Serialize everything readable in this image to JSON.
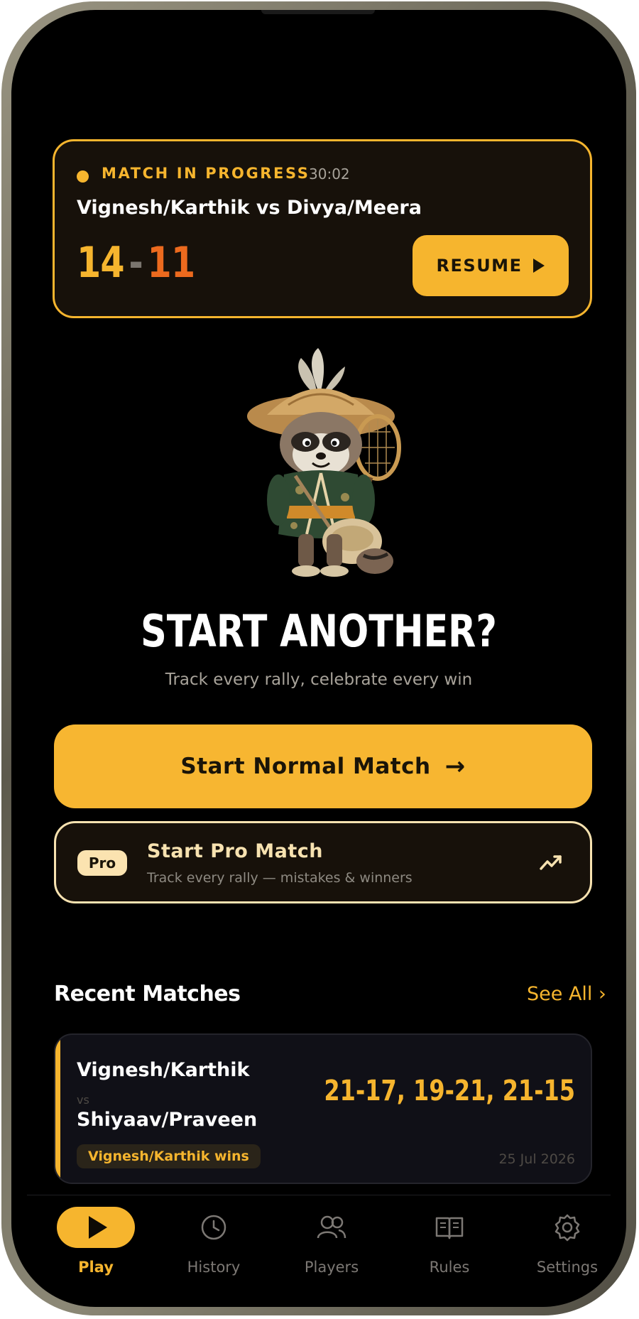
{
  "current_match": {
    "status_label": "MATCH IN PROGRESS",
    "timer": "30:02",
    "title": "Vignesh/Karthik vs Divya/Meera",
    "score_a": "14",
    "score_separator": "-",
    "score_b": "11",
    "resume_label": "RESUME"
  },
  "hero": {
    "title": "START ANOTHER?",
    "subtitle": "Track every rally, celebrate every win",
    "mascot_icon": "raccoon-badminton-mascot"
  },
  "actions": {
    "normal_label": "Start Normal Match",
    "pro_badge": "Pro",
    "pro_title": "Start Pro Match",
    "pro_subtitle": "Track every rally — mistakes & winners"
  },
  "recent": {
    "title": "Recent Matches",
    "see_all": "See All ›",
    "matches": [
      {
        "team_a": "Vignesh/Karthik",
        "vs": "vs",
        "team_b": "Shiyaav/Praveen",
        "winner": "Vignesh/Karthik wins",
        "scores": "21-17, 19-21, 21-15",
        "date": "25 Jul 2026"
      }
    ]
  },
  "nav": {
    "items": [
      {
        "label": "Play",
        "icon": "play-icon",
        "active": true
      },
      {
        "label": "History",
        "icon": "clock-icon"
      },
      {
        "label": "Players",
        "icon": "users-icon"
      },
      {
        "label": "Rules",
        "icon": "book-icon"
      },
      {
        "label": "Settings",
        "icon": "gear-icon"
      }
    ]
  },
  "colors": {
    "accent": "#f6b52e",
    "score_b": "#ec6a1e",
    "background": "#000000",
    "pro_outline": "#f7e2b0"
  }
}
